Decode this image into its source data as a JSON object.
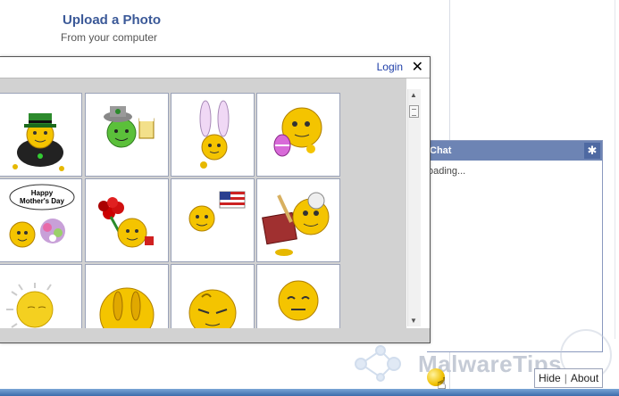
{
  "upload": {
    "title": "Upload a Photo",
    "subtitle": "From your computer"
  },
  "popup": {
    "login_label": "Login",
    "close_label": "✕",
    "emoticons": [
      "leprechaun-pot-of-gold",
      "leprechaun-beer",
      "easter-bunny-ears",
      "easter-egg",
      "mothers-day-sign",
      "flower-bouquet",
      "american-flag",
      "scroll-diploma",
      "sunny",
      "peeking",
      "content",
      "sad"
    ],
    "banner_text": [
      "Happy",
      "Mother's Day"
    ]
  },
  "chat": {
    "title": "Chat",
    "loading": "oading...",
    "gear_icon": "gear-icon"
  },
  "footer": {
    "hide_label": "Hide",
    "about_label": "About",
    "separator": "|"
  },
  "watermark": {
    "text": "MalwareTips"
  },
  "colors": {
    "accent": "#3b5998",
    "chat_header": "#6d84b4",
    "grid_bg": "#d2d2d2"
  }
}
